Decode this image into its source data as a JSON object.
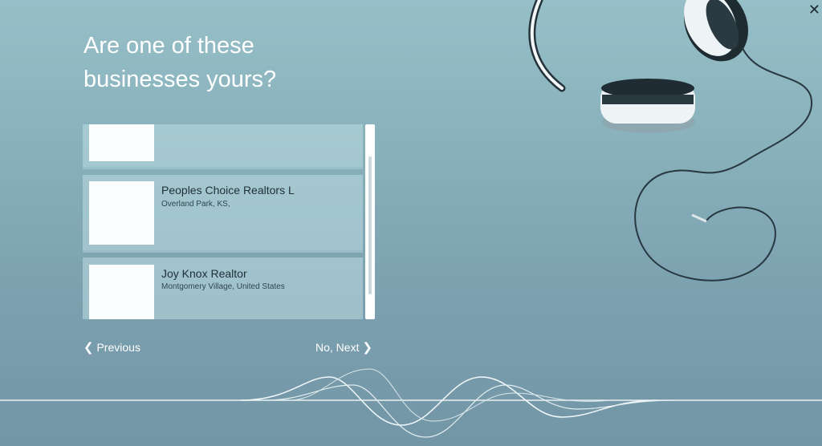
{
  "heading": {
    "line1": "Are one of these",
    "line2": "businesses yours?"
  },
  "businesses": [
    {
      "name": "",
      "location": ""
    },
    {
      "name": "Peoples Choice Realtors L",
      "location": "Overland Park, KS,"
    },
    {
      "name": "Joy Knox Realtor",
      "location": "Montgomery Village, United States"
    }
  ],
  "nav": {
    "previous_label": "Previous",
    "next_label": "No, Next"
  },
  "icons": {
    "close": "close-icon",
    "previous": "chevron-left-icon",
    "next": "chevron-right-icon"
  },
  "colors": {
    "background": "#87b0ba",
    "text": "#ffffff",
    "card": "#b9d4da"
  },
  "scroll_fraction": 0.25
}
